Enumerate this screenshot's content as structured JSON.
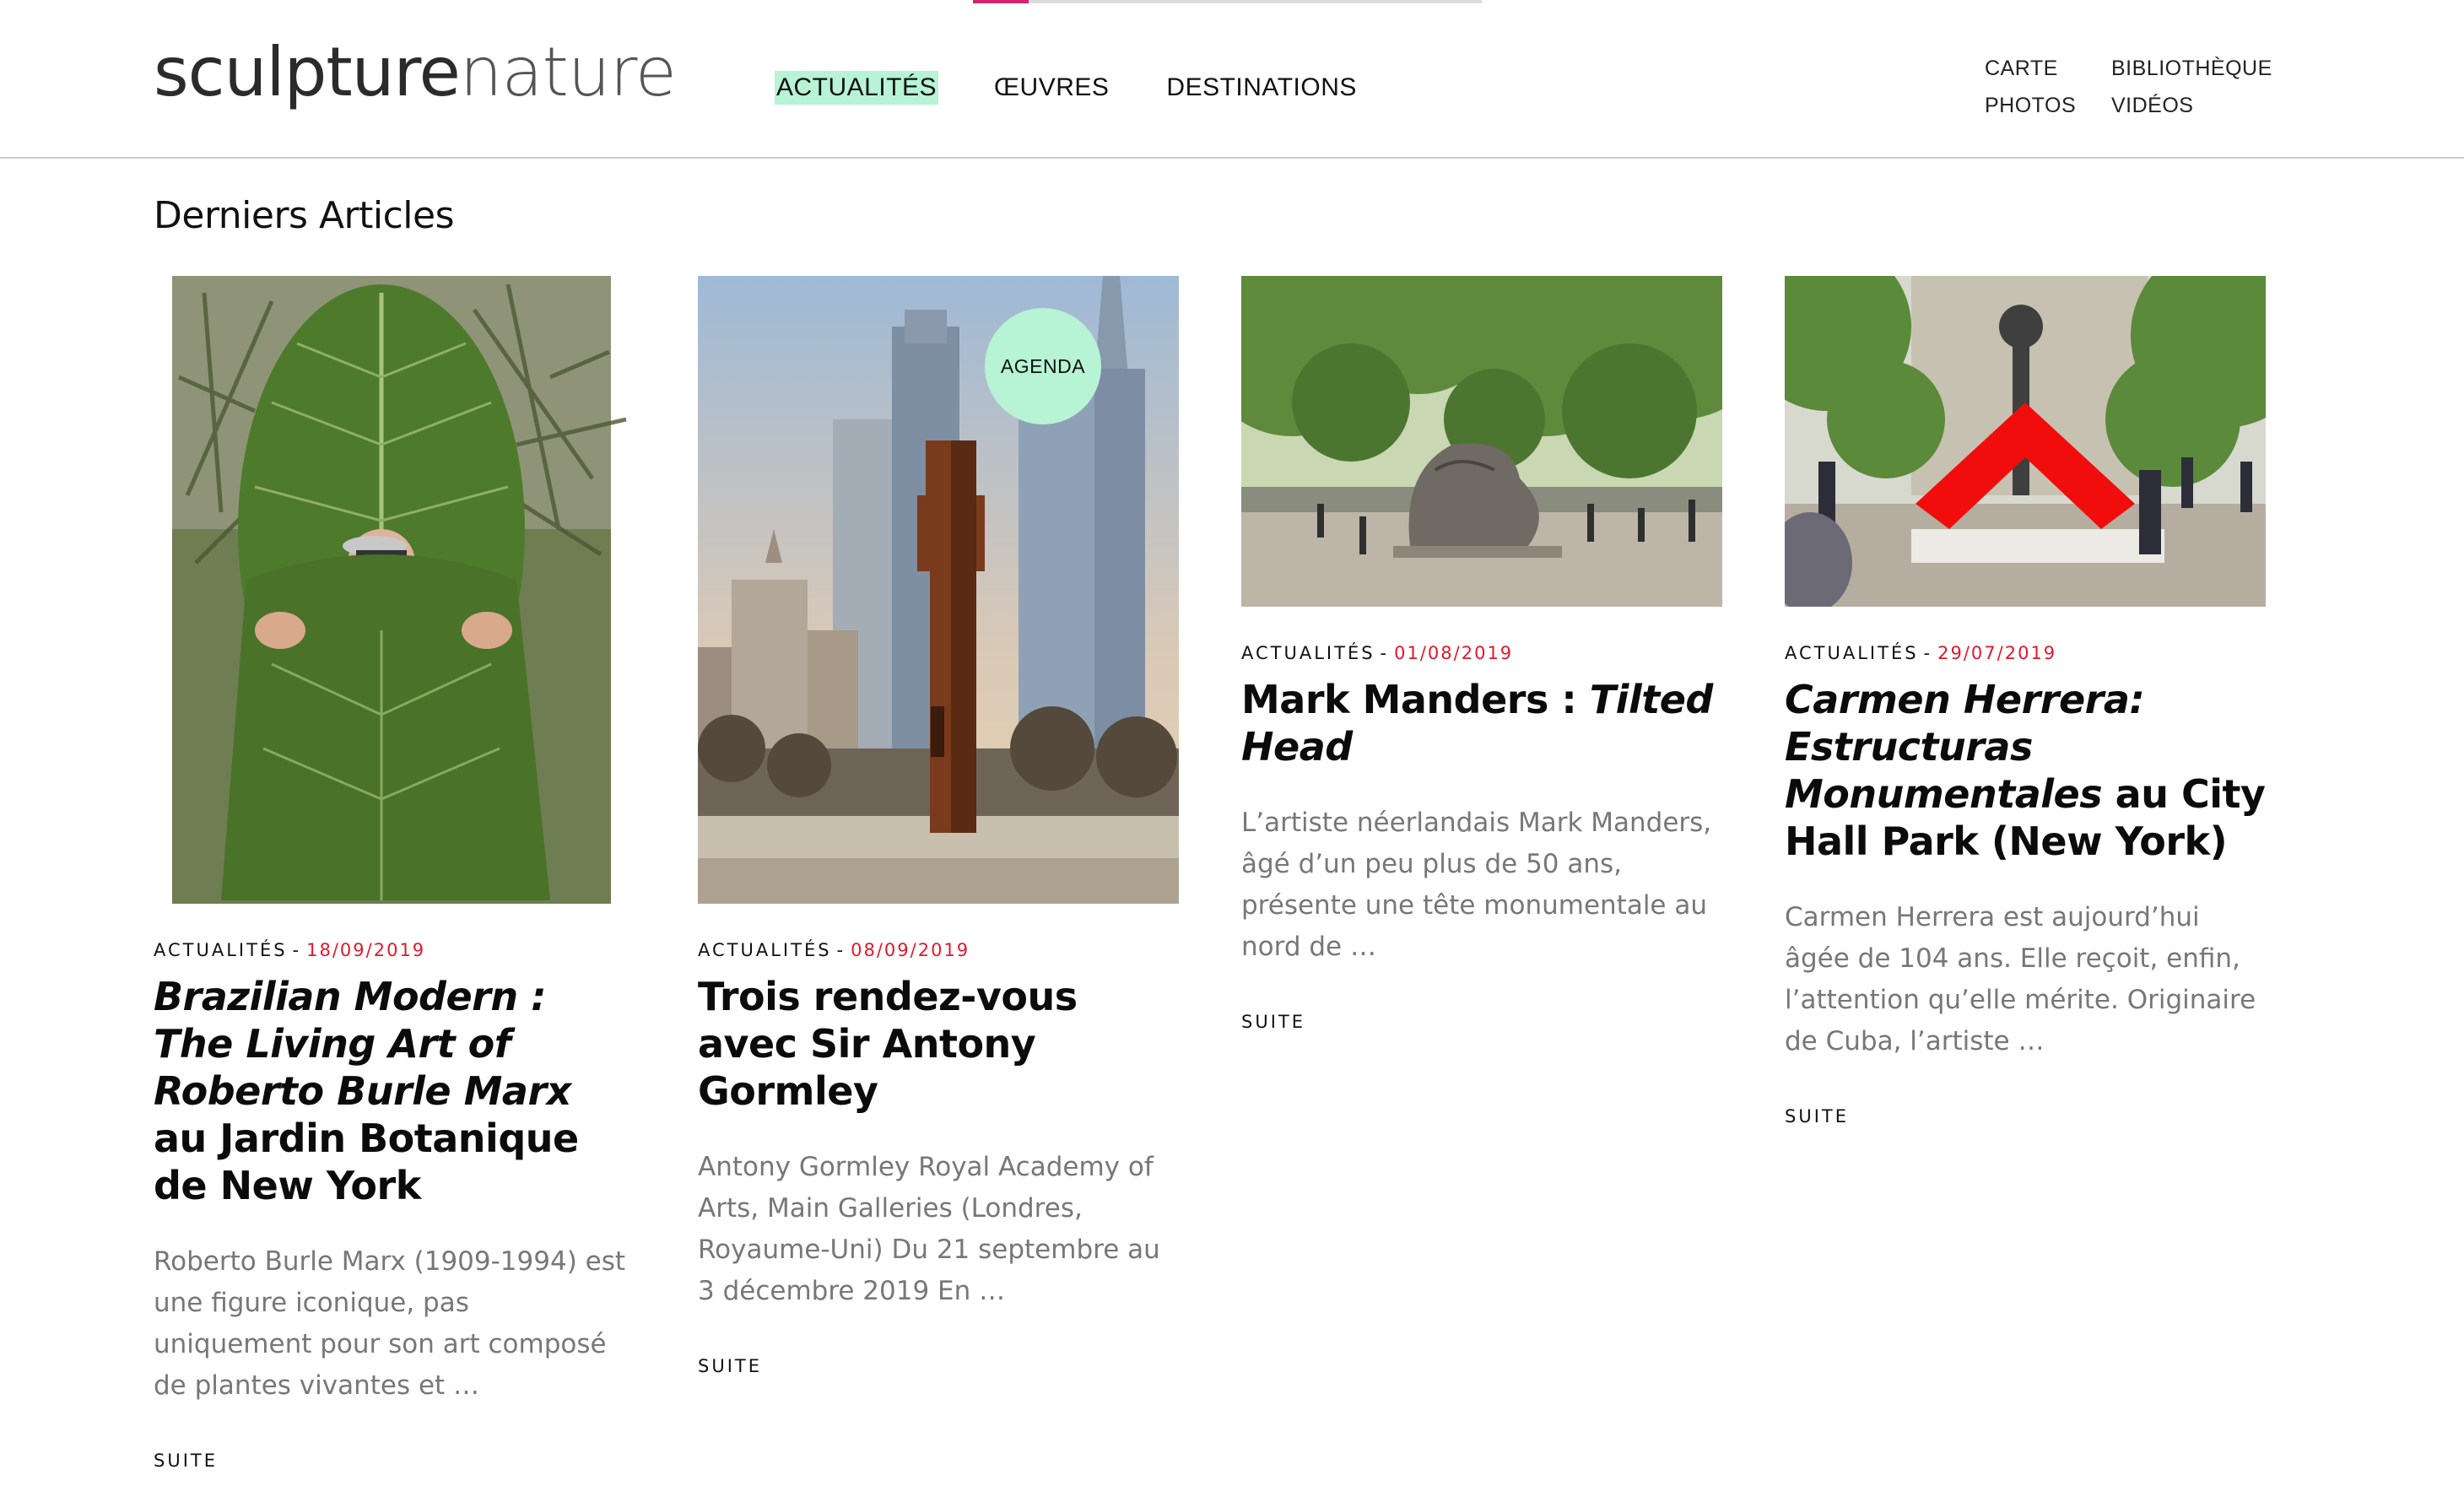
{
  "header": {
    "logo_bold": "sculpture",
    "logo_light": "nature",
    "reading_progress": 0.11,
    "nav": [
      {
        "label": "ACTUALITÉS",
        "active": true
      },
      {
        "label": "ŒUVRES",
        "active": false
      },
      {
        "label": "DESTINATIONS",
        "active": false
      }
    ],
    "utility_nav": [
      "CARTE",
      "BIBLIOTHÈQUE",
      "PHOTOS",
      "VIDÉOS"
    ]
  },
  "section": {
    "title": "Derniers Articles"
  },
  "articles": [
    {
      "category": "ACTUALITÉS",
      "separator": "-",
      "date": "18/09/2019",
      "title_italic": "Brazilian Modern : The Living Art of Roberto Burle Marx",
      "title_regular": " au Jardin Botanique de New York",
      "excerpt": "Roberto Burle Marx (1909-1994) est une figure iconique, pas uniquement pour son art composé de plantes vivantes et …",
      "more": "SUITE",
      "image": "man-behind-giant-leaf-photo"
    },
    {
      "category": "ACTUALITÉS",
      "separator": "-",
      "date": "08/09/2019",
      "title_italic": "",
      "title_regular": "Trois rendez-vous avec Sir Antony Gormley",
      "badge": "AGENDA",
      "excerpt": "Antony Gormley Royal Academy of Arts, Main Galleries (Londres, Royaume-Uni) Du 21 septembre au 3 décembre 2019 En …",
      "more": "SUITE",
      "image": "rusted-figure-sculpture-city-photo"
    },
    {
      "category": "ACTUALITÉS",
      "separator": "-",
      "date": "01/08/2019",
      "title_regular": "Mark Manders : ",
      "title_italic": "Tilted Head",
      "excerpt": "L’artiste néerlandais Mark Manders, âgé d’un peu plus de 50 ans, présente une tête monumentale au nord de …",
      "more": "SUITE",
      "image": "tilted-head-park-sculpture-photo"
    },
    {
      "category": "ACTUALITÉS",
      "separator": "-",
      "date": "29/07/2019",
      "title_italic": "Carmen Herrera: Estructuras Monumentales",
      "title_regular": " au City Hall Park (New York)",
      "excerpt": "Carmen Herrera est aujourd’hui âgée de 104 ans. Elle reçoit, enfin, l’attention qu’elle mérite. Originaire de Cuba, l’artiste …",
      "more": "SUITE",
      "image": "red-chevron-sculpture-park-photo"
    }
  ],
  "colors": {
    "accent_green": "#b7f3d5",
    "date_red": "#e3182d",
    "progress_pink": "#d1246f",
    "excerpt_grey": "#777777"
  }
}
